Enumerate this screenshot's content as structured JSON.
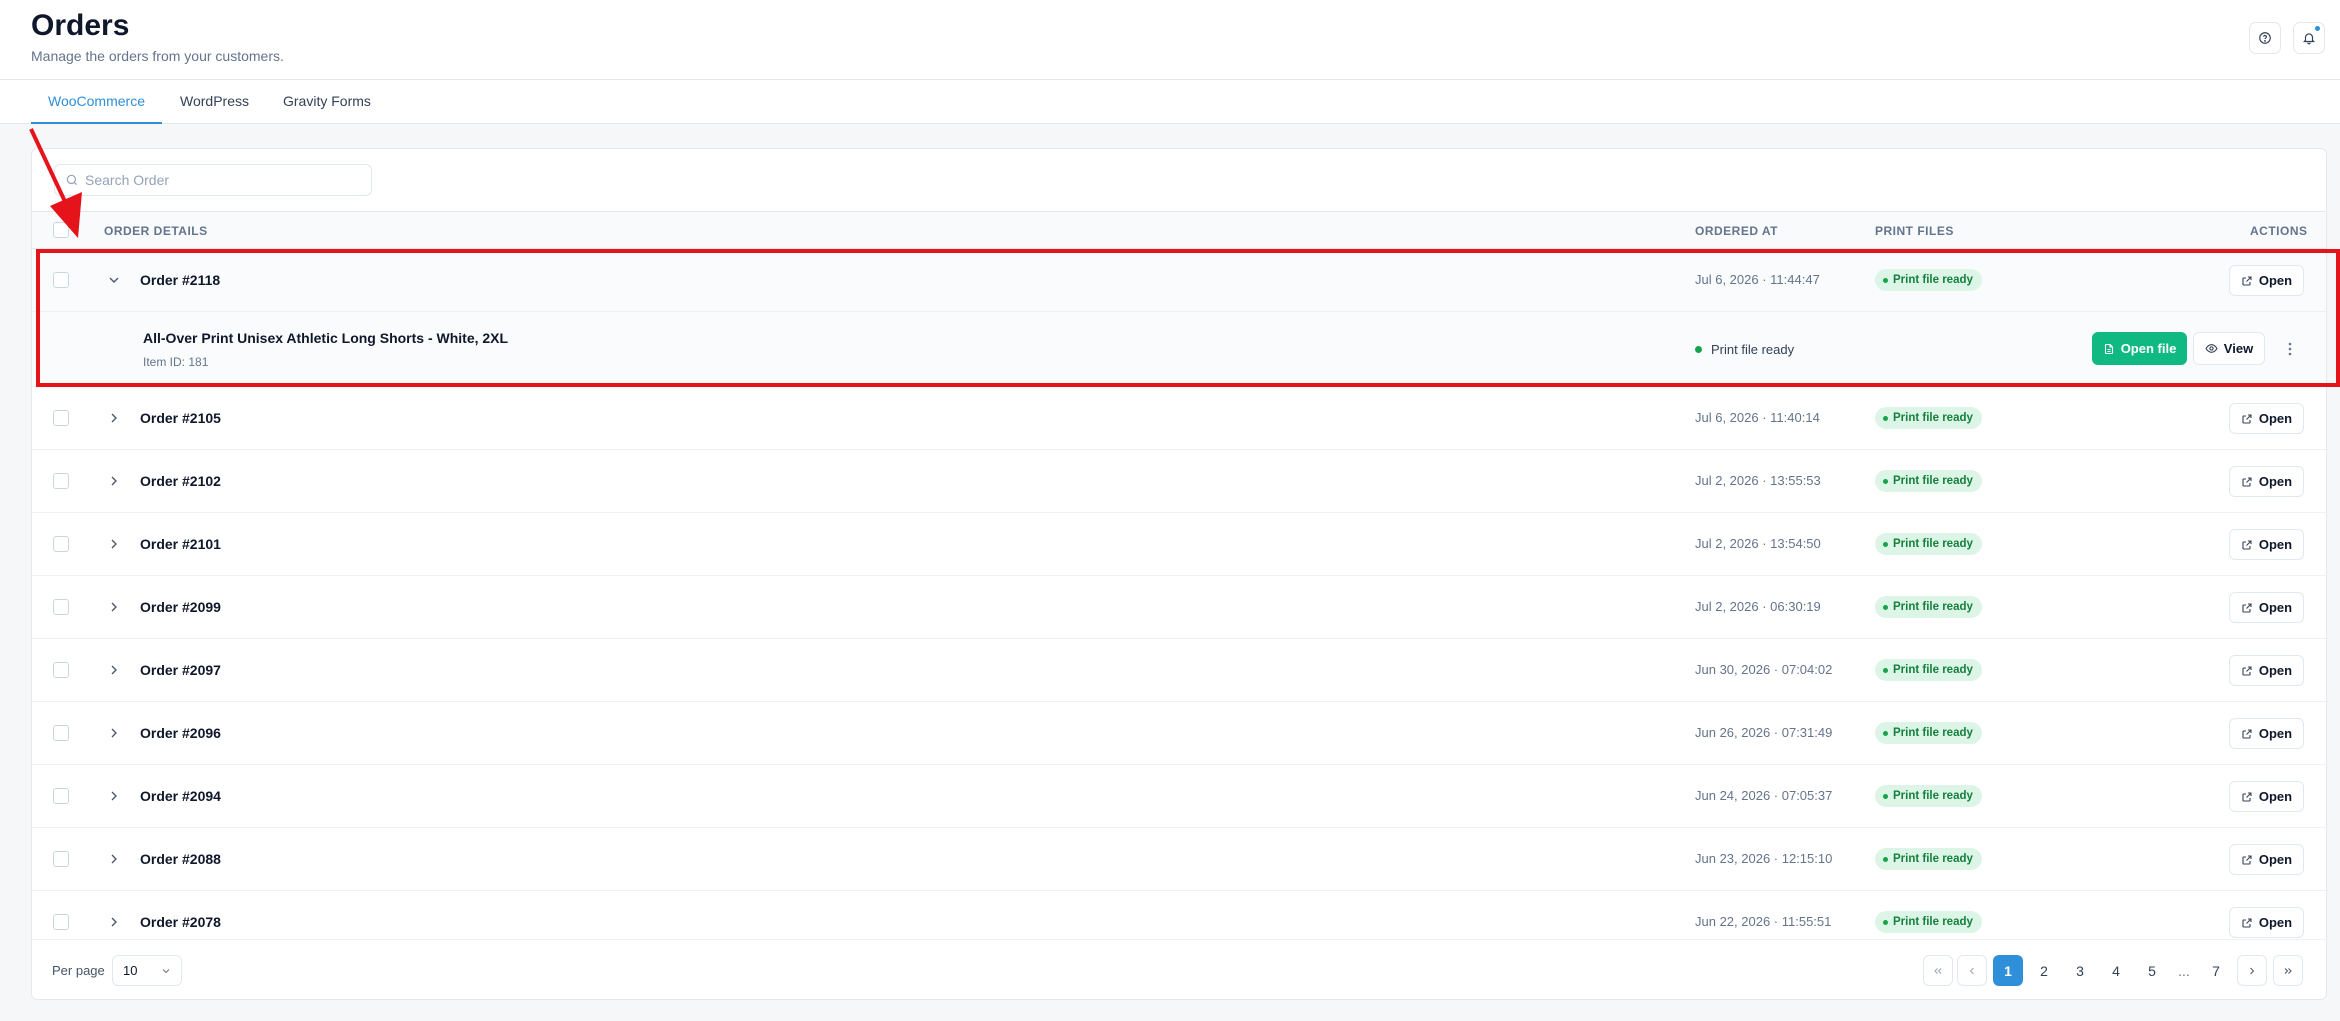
{
  "header": {
    "title": "Orders",
    "subtitle": "Manage the orders from your customers.",
    "help_icon": "help-circle-icon",
    "bell_icon": "bell-icon"
  },
  "tabs": [
    {
      "label": "WooCommerce",
      "active": true
    },
    {
      "label": "WordPress",
      "active": false
    },
    {
      "label": "Gravity Forms",
      "active": false
    }
  ],
  "search": {
    "placeholder": "Search Order",
    "value": ""
  },
  "table": {
    "columns": {
      "order_details": "ORDER DETAILS",
      "ordered_at": "ORDERED AT",
      "print_files": "PRINT FILES",
      "actions": "ACTIONS"
    },
    "open_label": "Open",
    "rows": [
      {
        "order": "Order #2118",
        "date": "Jul 6, 2026 · 11:44:47",
        "status": "Print file ready",
        "expanded": true
      },
      {
        "order": "Order #2105",
        "date": "Jul 6, 2026 · 11:40:14",
        "status": "Print file ready",
        "expanded": false
      },
      {
        "order": "Order #2102",
        "date": "Jul 2, 2026 · 13:55:53",
        "status": "Print file ready",
        "expanded": false
      },
      {
        "order": "Order #2101",
        "date": "Jul 2, 2026 · 13:54:50",
        "status": "Print file ready",
        "expanded": false
      },
      {
        "order": "Order #2099",
        "date": "Jul 2, 2026 · 06:30:19",
        "status": "Print file ready",
        "expanded": false
      },
      {
        "order": "Order #2097",
        "date": "Jun 30, 2026 · 07:04:02",
        "status": "Print file ready",
        "expanded": false
      },
      {
        "order": "Order #2096",
        "date": "Jun 26, 2026 · 07:31:49",
        "status": "Print file ready",
        "expanded": false
      },
      {
        "order": "Order #2094",
        "date": "Jun 24, 2026 · 07:05:37",
        "status": "Print file ready",
        "expanded": false
      },
      {
        "order": "Order #2088",
        "date": "Jun 23, 2026 · 12:15:10",
        "status": "Print file ready",
        "expanded": false
      },
      {
        "order": "Order #2078",
        "date": "Jun 22, 2026 · 11:55:51",
        "status": "Print file ready",
        "expanded": false
      }
    ],
    "expanded_item": {
      "name": "All-Over Print Unisex Athletic Long Shorts - White, 2XL",
      "item_id": "Item ID: 181",
      "status": "Print file ready",
      "open_file_label": "Open file",
      "view_label": "View",
      "more_icon": "more-vertical-icon"
    }
  },
  "footer": {
    "per_page_label": "Per page",
    "per_page_value": "10",
    "pages": [
      "1",
      "2",
      "3",
      "4",
      "5",
      "...",
      "7"
    ],
    "current_page": "1"
  },
  "colors": {
    "accent": "#2f8fd8",
    "success": "#10b981",
    "badge_bg": "#dcf5e7",
    "badge_text": "#15803d",
    "annotation": "#e5141a"
  }
}
